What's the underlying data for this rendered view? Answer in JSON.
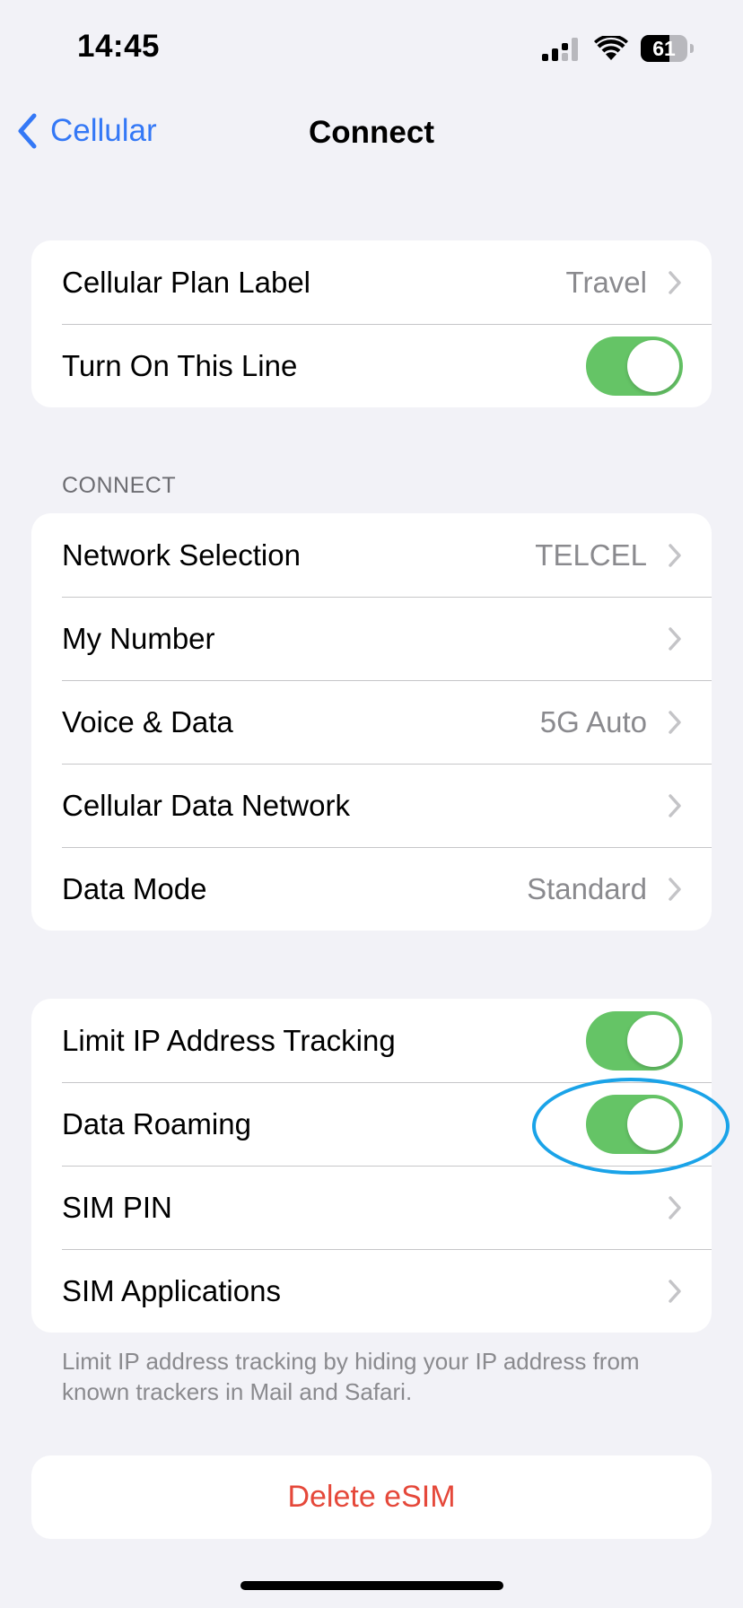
{
  "status_bar": {
    "time": "14:45",
    "battery_level": "61",
    "battery_fraction": 0.61
  },
  "nav": {
    "back_label": "Cellular",
    "title": "Connect"
  },
  "group1": {
    "plan_label": {
      "label": "Cellular Plan Label",
      "value": "Travel"
    },
    "turn_on_line": {
      "label": "Turn On This Line",
      "on": true
    }
  },
  "connect_section": {
    "header": "CONNECT",
    "rows": [
      {
        "label": "Network Selection",
        "value": "TELCEL"
      },
      {
        "label": "My Number",
        "value": ""
      },
      {
        "label": "Voice & Data",
        "value": "5G Auto"
      },
      {
        "label": "Cellular Data Network",
        "value": ""
      },
      {
        "label": "Data Mode",
        "value": "Standard"
      }
    ]
  },
  "group3": {
    "limit_ip": {
      "label": "Limit IP Address Tracking",
      "on": true
    },
    "data_roaming": {
      "label": "Data Roaming",
      "on": true
    },
    "sim_pin": {
      "label": "SIM PIN"
    },
    "sim_apps": {
      "label": "SIM Applications"
    },
    "footer": "Limit IP address tracking by hiding your IP address from known trackers in Mail and Safari."
  },
  "delete": {
    "label": "Delete eSIM"
  },
  "colors": {
    "accent": "#3478F6",
    "toggle_on": "#65C466",
    "destructive": "#E5483A",
    "highlight_ring": "#1AA3E8",
    "background": "#F2F2F7"
  }
}
